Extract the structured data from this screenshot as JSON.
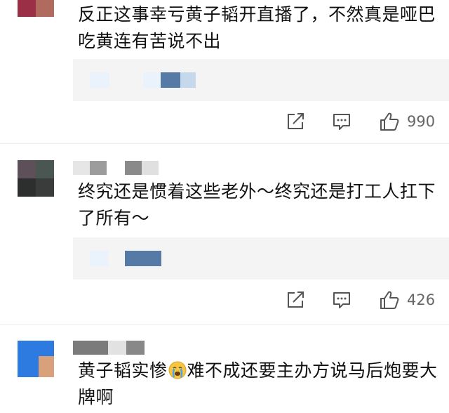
{
  "comments": [
    {
      "text": "反正这事幸亏黄子韬开直播了，不然真是哑巴吃黄连有苦说不出",
      "likes": "990"
    },
    {
      "text": "终究还是惯着这些老外～终究还是打工人扛下了所有～",
      "likes": "426"
    },
    {
      "text_before_emoji": "黄子韬实惨",
      "emoji": "crying-face",
      "text_after_emoji": "难不成还要主办方说马后炮要大牌啊"
    }
  ],
  "icons": {
    "share": "share-icon",
    "comment": "comment-icon",
    "like": "thumbs-up-icon"
  },
  "colors": {
    "reply_bg": "#f4f4f4",
    "icon_gray": "#555555",
    "count_gray": "#666666"
  }
}
